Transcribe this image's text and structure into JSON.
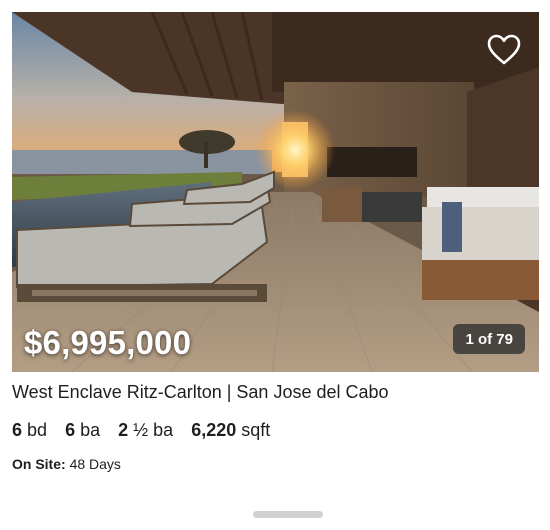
{
  "listing": {
    "price": "$6,995,000",
    "photo_counter": "1 of 79",
    "title": "West Enclave Ritz-Carlton | San Jose del Cabo",
    "facts": [
      {
        "value": "6",
        "unit": "bd"
      },
      {
        "value": "6",
        "unit": "ba"
      },
      {
        "value": "2",
        "unit": "½ ba"
      },
      {
        "value": "6,220",
        "unit": "sqft"
      }
    ],
    "on_site_label": "On Site:",
    "on_site_value": "48 Days"
  },
  "icons": {
    "favorite": "heart-outline-icon"
  },
  "colors": {
    "overlay_badge": "#2d2d2d",
    "text": "#1f1f1f",
    "scroll_handle": "#d0d0d0"
  }
}
